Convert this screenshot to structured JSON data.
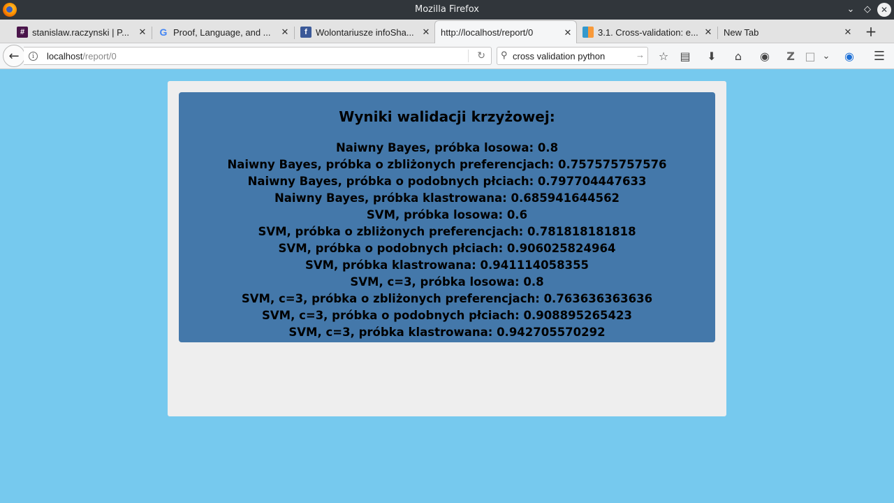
{
  "window": {
    "title": "Mozilla Firefox"
  },
  "tabs": [
    {
      "label": "stanislaw.raczynski | P...",
      "icon": "hash-icon",
      "active": false
    },
    {
      "label": "Proof, Language, and ...",
      "icon": "google-icon",
      "active": false
    },
    {
      "label": "Wolontariusze infoSha...",
      "icon": "facebook-icon",
      "active": false
    },
    {
      "label": "http://localhost/report/0",
      "icon": "",
      "active": true
    },
    {
      "label": "3.1. Cross-validation: e...",
      "icon": "sklearn-icon",
      "active": false
    },
    {
      "label": "New Tab",
      "icon": "",
      "active": false
    }
  ],
  "navbar": {
    "url_host": "localhost",
    "url_path": "/report/0",
    "search_value": "cross validation python"
  },
  "report": {
    "heading": "Wyniki walidacji krzyżowej:",
    "results": [
      "Naiwny Bayes, próbka losowa: 0.8",
      "Naiwny Bayes, próbka o zbliżonych preferencjach: 0.757575757576",
      "Naiwny Bayes, próbka o podobnych płciach: 0.797704447633",
      "Naiwny Bayes, próbka klastrowana: 0.685941644562",
      "SVM, próbka losowa: 0.6",
      "SVM, próbka o zbliżonych preferencjach: 0.781818181818",
      "SVM, próbka o podobnych płciach: 0.906025824964",
      "SVM, próbka klastrowana: 0.941114058355",
      "SVM, c=3, próbka losowa: 0.8",
      "SVM, c=3, próbka o zbliżonych preferencjach: 0.763636363636",
      "SVM, c=3, próbka o podobnych płciach: 0.908895265423",
      "SVM, c=3, próbka klastrowana: 0.942705570292"
    ]
  },
  "colors": {
    "page_background": "#76c9ee",
    "panel_background": "#eeeeee",
    "results_background": "#4478aa"
  }
}
